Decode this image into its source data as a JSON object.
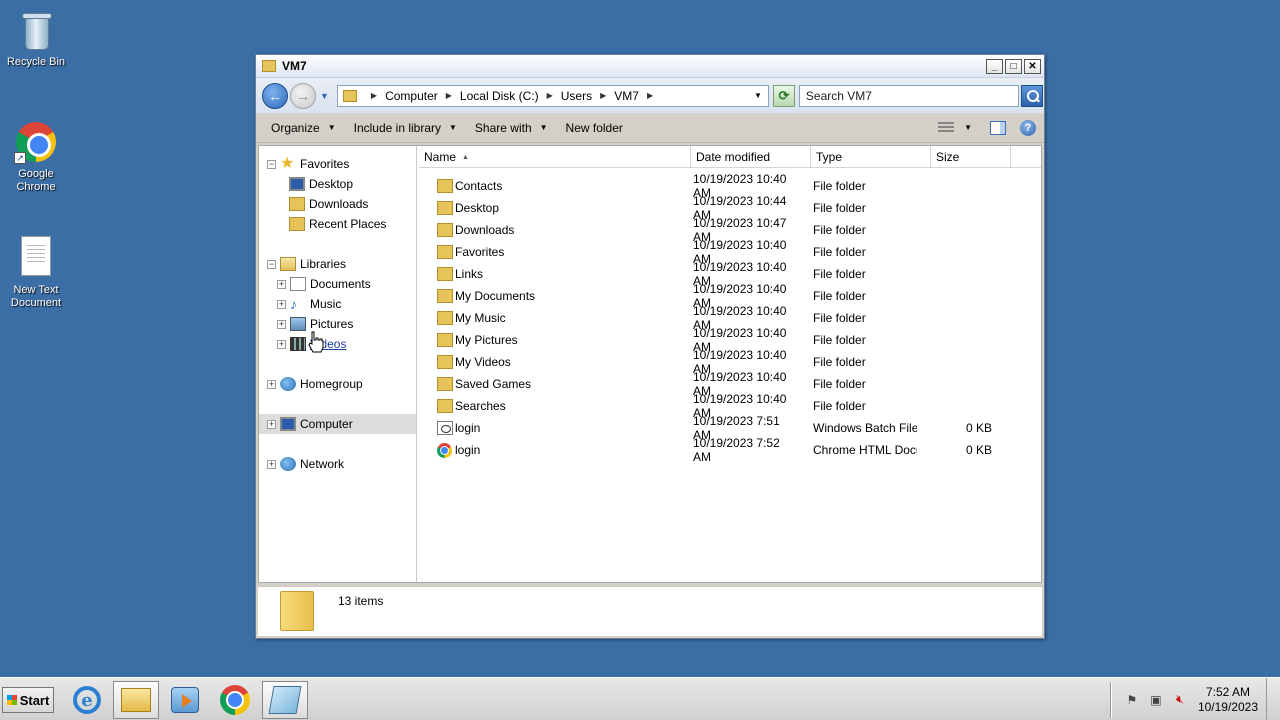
{
  "desktop": {
    "icons": [
      {
        "label": "Recycle Bin",
        "icon": "recycle-bin-icon"
      },
      {
        "label": "Google Chrome",
        "icon": "chrome-icon"
      },
      {
        "label": "New Text Document",
        "icon": "text-document-icon"
      }
    ]
  },
  "window": {
    "title": "VM7",
    "controls": {
      "minimize": "_",
      "maximize": "□",
      "close": "✕"
    },
    "address": {
      "crumbs": [
        "Computer",
        "Local Disk (C:)",
        "Users",
        "VM7"
      ]
    },
    "search": {
      "placeholder": "Search VM7"
    },
    "commands": {
      "organize": "Organize",
      "include_in_library": "Include in library",
      "share_with": "Share with",
      "new_folder": "New folder"
    },
    "nav": {
      "favorites": "Favorites",
      "favorites_items": [
        "Desktop",
        "Downloads",
        "Recent Places"
      ],
      "libraries": "Libraries",
      "libraries_items": [
        "Documents",
        "Music",
        "Pictures",
        "Videos"
      ],
      "homegroup": "Homegroup",
      "computer": "Computer",
      "network": "Network"
    },
    "columns": {
      "name": "Name",
      "date": "Date modified",
      "type": "Type",
      "size": "Size"
    },
    "files": [
      {
        "name": "Contacts",
        "date": "10/19/2023 10:40 AM",
        "type": "File folder",
        "size": "",
        "icon": "contacts-folder-icon"
      },
      {
        "name": "Desktop",
        "date": "10/19/2023 10:44 AM",
        "type": "File folder",
        "size": "",
        "icon": "desktop-folder-icon"
      },
      {
        "name": "Downloads",
        "date": "10/19/2023 10:47 AM",
        "type": "File folder",
        "size": "",
        "icon": "downloads-folder-icon"
      },
      {
        "name": "Favorites",
        "date": "10/19/2023 10:40 AM",
        "type": "File folder",
        "size": "",
        "icon": "favorites-folder-icon"
      },
      {
        "name": "Links",
        "date": "10/19/2023 10:40 AM",
        "type": "File folder",
        "size": "",
        "icon": "links-folder-icon"
      },
      {
        "name": "My Documents",
        "date": "10/19/2023 10:40 AM",
        "type": "File folder",
        "size": "",
        "icon": "documents-folder-icon"
      },
      {
        "name": "My Music",
        "date": "10/19/2023 10:40 AM",
        "type": "File folder",
        "size": "",
        "icon": "music-folder-icon"
      },
      {
        "name": "My Pictures",
        "date": "10/19/2023 10:40 AM",
        "type": "File folder",
        "size": "",
        "icon": "pictures-folder-icon"
      },
      {
        "name": "My Videos",
        "date": "10/19/2023 10:40 AM",
        "type": "File folder",
        "size": "",
        "icon": "videos-folder-icon"
      },
      {
        "name": "Saved Games",
        "date": "10/19/2023 10:40 AM",
        "type": "File folder",
        "size": "",
        "icon": "saved-games-folder-icon"
      },
      {
        "name": "Searches",
        "date": "10/19/2023 10:40 AM",
        "type": "File folder",
        "size": "",
        "icon": "searches-folder-icon"
      },
      {
        "name": "login",
        "date": "10/19/2023 7:51 AM",
        "type": "Windows Batch File",
        "size": "0 KB",
        "icon": "batch-file-icon"
      },
      {
        "name": "login",
        "date": "10/19/2023 7:52 AM",
        "type": "Chrome HTML Docu...",
        "size": "0 KB",
        "icon": "chrome-html-icon"
      }
    ],
    "status": {
      "item_count": "13 items"
    }
  },
  "taskbar": {
    "start_label": "Start",
    "apps": [
      "internet-explorer-icon",
      "windows-explorer-icon",
      "media-player-icon",
      "chrome-icon",
      "notepad-icon"
    ],
    "clock": {
      "time": "7:52 AM",
      "date": "10/19/2023"
    }
  },
  "colors": {
    "desktop": "#3a6ea5",
    "accent": "#2d68b8"
  }
}
